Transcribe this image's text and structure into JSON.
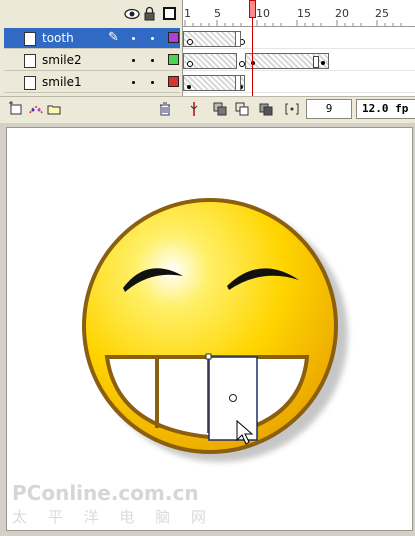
{
  "timeline": {
    "layers": [
      {
        "name": "tooth",
        "selected": true,
        "color": "#b23ed6",
        "pencil": true
      },
      {
        "name": "smile2",
        "selected": false,
        "color": "#4fd34f"
      },
      {
        "name": "smile1",
        "selected": false,
        "color": "#e03030"
      }
    ],
    "ruler": [
      "1",
      "5",
      "10",
      "15",
      "20",
      "25"
    ],
    "current_frame": "9",
    "frame_rate": "12.0 fp",
    "header_icons": [
      "eye-icon",
      "lock-icon",
      "outline-icon"
    ],
    "bottom_icons": [
      "insert-layer-icon",
      "add-motion-guide-icon",
      "insert-folder-icon",
      "delete-layer-icon",
      "center-frame-icon",
      "onion-skin-icon",
      "onion-skin-outline-icon",
      "edit-multiple-frames-icon",
      "modify-onion-markers-icon"
    ]
  },
  "watermark": {
    "line1": "PConline.com.cn",
    "line2": "太 平 洋 电 脑 网"
  },
  "colors": {
    "face_fill": "#ffd81a",
    "face_outline": "#8a6010",
    "selection_blue": "#316ac5"
  }
}
